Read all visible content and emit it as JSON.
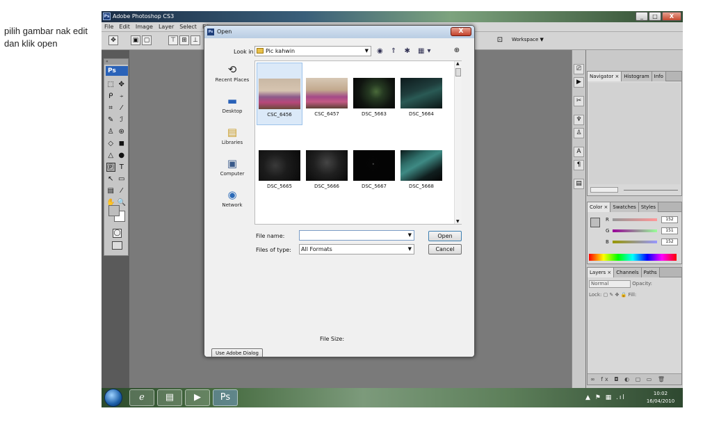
{
  "note": "pilih gambar nak edit dan klik open",
  "app": {
    "title": "Adobe Photoshop CS3",
    "window_buttons": {
      "min": "_",
      "max": "□",
      "close": "X"
    },
    "menu": [
      "File",
      "Edit",
      "Image",
      "Layer",
      "Select",
      "Filt"
    ],
    "workspace_label": "Workspace ▼"
  },
  "toolbox": {
    "logo": "Ps",
    "tools": [
      [
        "⬚",
        "✥"
      ],
      [
        "ᑭ",
        "⍆"
      ],
      [
        "⌗",
        "⁄"
      ],
      [
        "✎",
        "ℐ"
      ],
      [
        "♙",
        "⊛"
      ],
      [
        "◇",
        "◼"
      ],
      [
        "△",
        "●"
      ],
      [
        "Ⓟ",
        "T"
      ],
      [
        "↖",
        "▭"
      ],
      [
        "▤",
        "⁄"
      ],
      [
        "✋",
        "🔍"
      ]
    ]
  },
  "panels": {
    "navigator_tabs": [
      "Navigator ×",
      "Histogram",
      "Info"
    ],
    "color_tabs": [
      "Color ×",
      "Swatches",
      "Styles"
    ],
    "color_rows": [
      {
        "label": "R",
        "value": "152"
      },
      {
        "label": "G",
        "value": "151"
      },
      {
        "label": "B",
        "value": "152"
      }
    ],
    "layers_tabs": [
      "Layers ×",
      "Channels",
      "Paths"
    ],
    "blend_mode": "Normal",
    "opacity_label": "Opacity:",
    "lock_label": "Lock:",
    "fill_label": "Fill:",
    "footer_icons": "∞ fx ◘ ◐ ▢ ▭ 🗑"
  },
  "dialog": {
    "title": "Open",
    "close": "X",
    "look_in_label": "Look in",
    "look_in_value": "Pic kahwin",
    "nav_icons": "◉ ⇑ ✱ ▦▾",
    "places": [
      "Recent Places",
      "Desktop",
      "Libraries",
      "Computer",
      "Network"
    ],
    "files": [
      "CSC_6456",
      "CSC_6457",
      "DSC_5663",
      "DSC_5664",
      "DSC_5665",
      "DSC_5666",
      "DSC_5667",
      "DSC_5668"
    ],
    "file_name_label": "File name:",
    "file_name_value": "",
    "files_of_type_label": "Files of type:",
    "files_of_type_value": "All Formats",
    "open_button": "Open",
    "cancel_button": "Cancel",
    "file_size_label": "File Size:",
    "use_adobe_dialog": "Use Adobe Dialog"
  },
  "taskbar": {
    "tray": "▲ ⚑ ▦ .ıl ◄)",
    "time": "10:02",
    "date": "16/04/2010",
    "ps_label": "Ps"
  }
}
